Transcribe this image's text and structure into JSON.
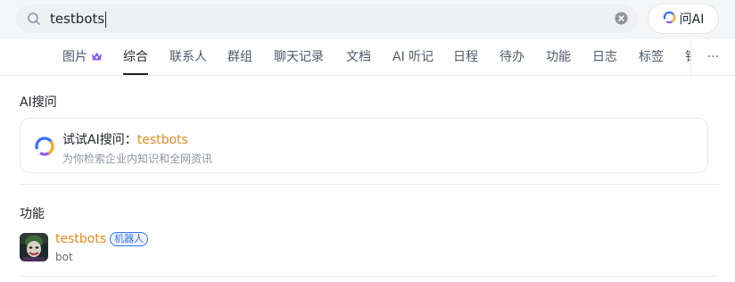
{
  "search": {
    "value": "testbots",
    "ask_ai_label": "问AI"
  },
  "tabs": [
    {
      "label": "图片",
      "active": false
    },
    {
      "label": "综合",
      "active": true
    },
    {
      "label": "联系人",
      "active": false
    },
    {
      "label": "群组",
      "active": false
    },
    {
      "label": "聊天记录",
      "active": false
    },
    {
      "label": "文档",
      "active": false
    },
    {
      "label": "AI 听记",
      "active": false
    },
    {
      "label": "日程",
      "active": false
    },
    {
      "label": "待办",
      "active": false
    },
    {
      "label": "功能",
      "active": false
    },
    {
      "label": "日志",
      "active": false
    },
    {
      "label": "标签",
      "active": false
    },
    {
      "label": "钉",
      "active": false
    }
  ],
  "more_label": "···",
  "ai_section": {
    "title": "AI搜问",
    "card_prefix": "试试AI搜问：",
    "card_keyword": "testbots",
    "card_sub": "为你检索企业内知识和全网资讯"
  },
  "func_section": {
    "title": "功能",
    "item": {
      "name": "testbots",
      "badge": "机器人",
      "sub": "bot"
    }
  },
  "colors": {
    "accent": "#e68a1f",
    "badge_blue": "#3370ff",
    "premium_purple": "#8a5cf5"
  },
  "icons": {
    "search": "search-icon",
    "clear": "clear-icon",
    "ai": "ai-logo-icon",
    "crown": "crown-icon"
  }
}
